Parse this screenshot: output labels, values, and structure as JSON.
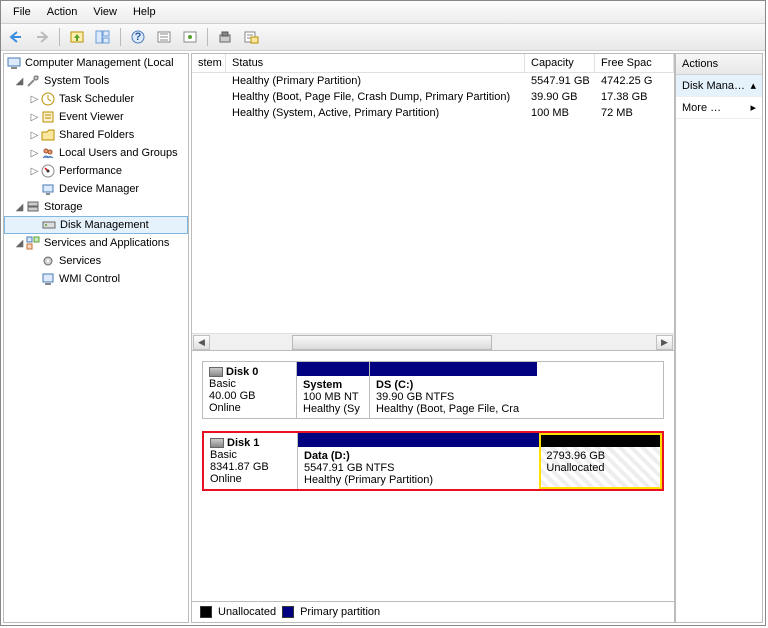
{
  "menu": {
    "file": "File",
    "action": "Action",
    "view": "View",
    "help": "Help"
  },
  "tree": {
    "root": "Computer Management (Local",
    "system_tools": "System Tools",
    "task_scheduler": "Task Scheduler",
    "event_viewer": "Event Viewer",
    "shared_folders": "Shared Folders",
    "local_users": "Local Users and Groups",
    "performance": "Performance",
    "device_manager": "Device Manager",
    "storage": "Storage",
    "disk_management": "Disk Management",
    "services_apps": "Services and Applications",
    "services": "Services",
    "wmi": "WMI Control"
  },
  "columns": {
    "stem": "stem",
    "status": "Status",
    "capacity": "Capacity",
    "free": "Free Spac"
  },
  "volumes": [
    {
      "status": "Healthy (Primary Partition)",
      "capacity": "5547.91 GB",
      "free": "4742.25 G"
    },
    {
      "status": "Healthy (Boot, Page File, Crash Dump, Primary Partition)",
      "capacity": "39.90 GB",
      "free": "17.38 GB"
    },
    {
      "status": "Healthy (System, Active, Primary Partition)",
      "capacity": "100 MB",
      "free": "72 MB"
    }
  ],
  "disks": {
    "d0_name": "Disk 0",
    "d0_type": "Basic",
    "d0_size": "40.00 GB",
    "d0_state": "Online",
    "d0_p0_name": "System",
    "d0_p0_size": "100 MB NT",
    "d0_p0_status": "Healthy (Sy",
    "d0_p1_name": "DS  (C:)",
    "d0_p1_size": "39.90 GB NTFS",
    "d0_p1_status": "Healthy (Boot, Page File, Cra",
    "d1_name": "Disk 1",
    "d1_type": "Basic",
    "d1_size": "8341.87 GB",
    "d1_state": "Online",
    "d1_p0_name": "Data  (D:)",
    "d1_p0_size": "5547.91 GB NTFS",
    "d1_p0_status": "Healthy (Primary Partition)",
    "d1_p1_size": "2793.96 GB",
    "d1_p1_status": "Unallocated"
  },
  "legend": {
    "unallocated": "Unallocated",
    "primary": "Primary partition"
  },
  "actions": {
    "title": "Actions",
    "disk_mgmt": "Disk Mana…",
    "more": "More …"
  }
}
